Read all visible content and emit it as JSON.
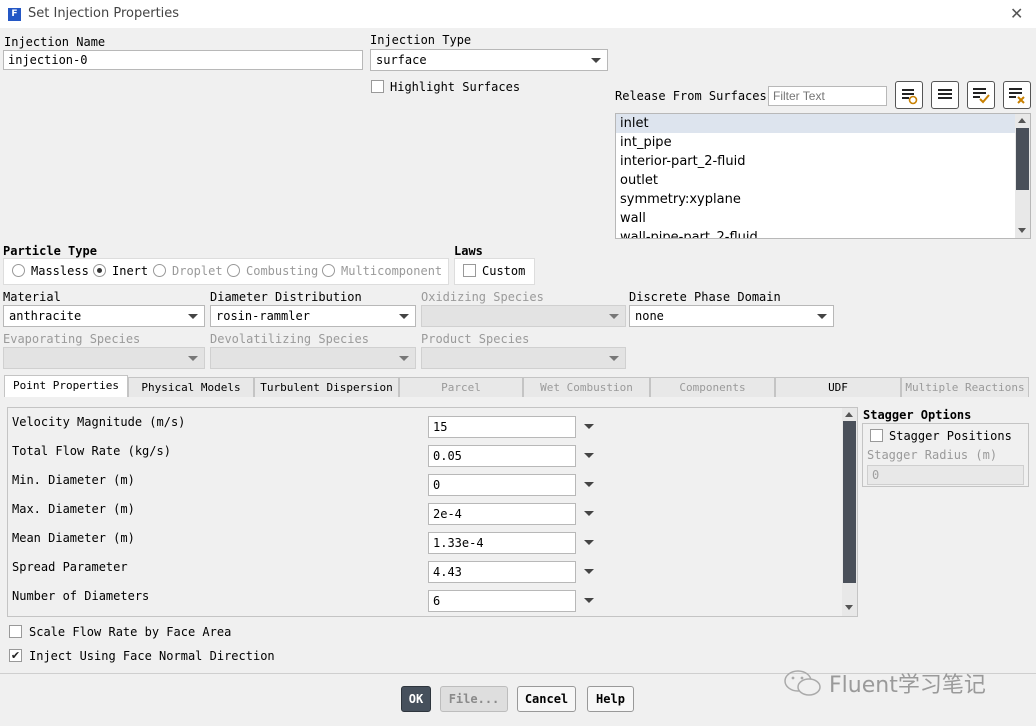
{
  "window": {
    "title": "Set Injection Properties",
    "icon": "fluent-app-icon",
    "close_glyph": "✕"
  },
  "injection_name": {
    "label": "Injection Name",
    "value": "injection-0"
  },
  "injection_type": {
    "label": "Injection Type",
    "value": "surface"
  },
  "highlight_surfaces": {
    "label": "Highlight Surfaces",
    "checked": false
  },
  "release_from_surfaces": {
    "label": "Release From Surfaces",
    "filter_placeholder": "Filter Text",
    "items": [
      "inlet",
      "int_pipe",
      "interior-part_2-fluid",
      "outlet",
      "symmetry:xyplane",
      "wall",
      "wall-pipe-part_2-fluid"
    ],
    "selected": "inlet",
    "icons": [
      "select-by-pattern-icon",
      "list-icon",
      "select-all-icon",
      "deselect-all-icon"
    ]
  },
  "particle_type": {
    "label": "Particle Type",
    "options": [
      {
        "label": "Massless",
        "selected": false,
        "enabled": true
      },
      {
        "label": "Inert",
        "selected": true,
        "enabled": true
      },
      {
        "label": "Droplet",
        "selected": false,
        "enabled": false
      },
      {
        "label": "Combusting",
        "selected": false,
        "enabled": false
      },
      {
        "label": "Multicomponent",
        "selected": false,
        "enabled": false
      }
    ]
  },
  "laws": {
    "label": "Laws",
    "custom_label": "Custom",
    "custom_checked": false
  },
  "material": {
    "label": "Material",
    "value": "anthracite"
  },
  "diameter_distribution": {
    "label": "Diameter Distribution",
    "value": "rosin-rammler"
  },
  "oxidizing_species": {
    "label": "Oxidizing Species",
    "value": ""
  },
  "discrete_phase_domain": {
    "label": "Discrete Phase Domain",
    "value": "none"
  },
  "evaporating_species": {
    "label": "Evaporating Species",
    "value": ""
  },
  "devolatilizing_species": {
    "label": "Devolatilizing Species",
    "value": ""
  },
  "product_species": {
    "label": "Product Species",
    "value": ""
  },
  "tabs": [
    {
      "label": "Point Properties",
      "active": true,
      "enabled": true
    },
    {
      "label": "Physical Models",
      "active": false,
      "enabled": true
    },
    {
      "label": "Turbulent Dispersion",
      "active": false,
      "enabled": true
    },
    {
      "label": "Parcel",
      "active": false,
      "enabled": false
    },
    {
      "label": "Wet Combustion",
      "active": false,
      "enabled": false
    },
    {
      "label": "Components",
      "active": false,
      "enabled": false
    },
    {
      "label": "UDF",
      "active": false,
      "enabled": true
    },
    {
      "label": "Multiple Reactions",
      "active": false,
      "enabled": false
    }
  ],
  "point_properties": [
    {
      "label": "Velocity Magnitude (m/s)",
      "value": "15"
    },
    {
      "label": "Total Flow Rate (kg/s)",
      "value": "0.05"
    },
    {
      "label": "Min. Diameter (m)",
      "value": "0"
    },
    {
      "label": "Max. Diameter (m)",
      "value": "2e-4"
    },
    {
      "label": "Mean Diameter (m)",
      "value": "1.33e-4"
    },
    {
      "label": "Spread Parameter",
      "value": "4.43"
    },
    {
      "label": "Number of Diameters",
      "value": "6"
    }
  ],
  "stagger_options": {
    "label": "Stagger Options",
    "stagger_positions_label": "Stagger Positions",
    "stagger_positions_checked": false,
    "stagger_radius_label": "Stagger Radius (m)",
    "stagger_radius_value": "0"
  },
  "scale_flow_rate": {
    "label": "Scale Flow Rate by Face Area",
    "checked": false
  },
  "inject_normal": {
    "label": "Inject Using Face Normal Direction",
    "checked": true
  },
  "buttons": {
    "ok": "OK",
    "file": "File...",
    "cancel": "Cancel",
    "help": "Help"
  },
  "watermark": {
    "text": "Fluent学习笔记"
  }
}
